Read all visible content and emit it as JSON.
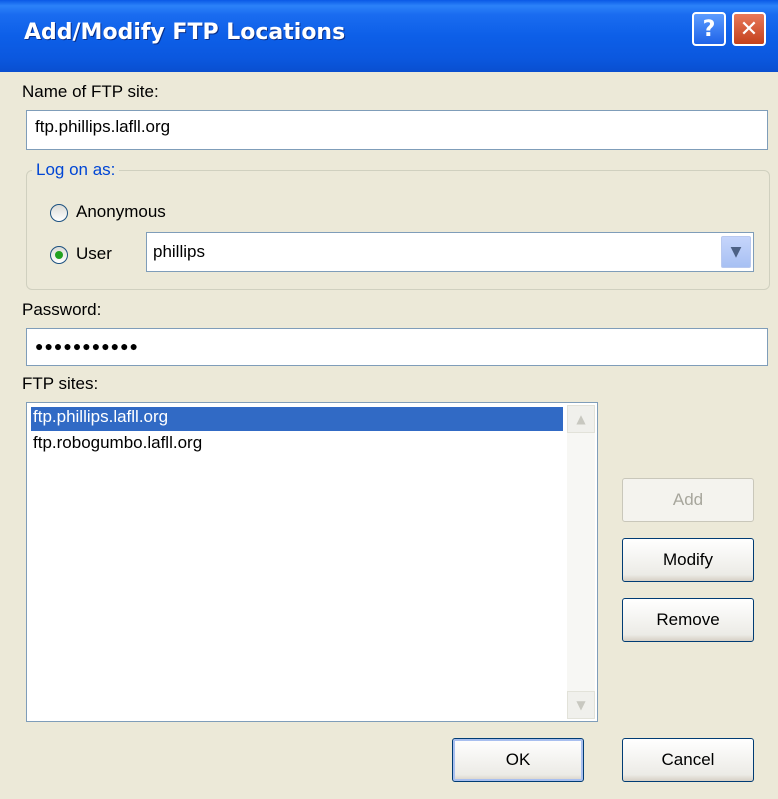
{
  "dialog": {
    "title": "Add/Modify FTP Locations",
    "help_glyph": "?",
    "close_glyph": "✕"
  },
  "site_name": {
    "label": "Name of FTP site:",
    "value": "ftp.phillips.lafll.org"
  },
  "logon": {
    "legend": "Log on as:",
    "anonymous_label": "Anonymous",
    "user_label": "User",
    "selected": "User",
    "user_value": "phillips"
  },
  "password": {
    "label": "Password:",
    "masked_value": "●●●●●●●●●●●"
  },
  "ftp_sites": {
    "label": "FTP sites:",
    "items": [
      "ftp.phillips.lafll.org",
      "ftp.robogumbo.lafll.org"
    ],
    "selected_index": 0
  },
  "buttons": {
    "add": "Add",
    "modify": "Modify",
    "remove": "Remove",
    "ok": "OK",
    "cancel": "Cancel"
  },
  "colors": {
    "titlebar": "#0a59e6",
    "selection": "#316ac5",
    "group_legend": "#0046d5"
  }
}
